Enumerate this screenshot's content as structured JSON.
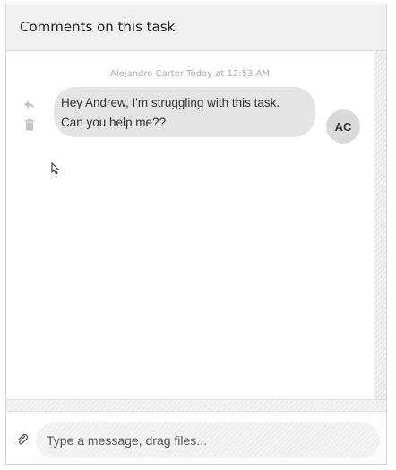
{
  "header": {
    "title": "Comments on this task"
  },
  "thread": {
    "messages": [
      {
        "author": "Alejandro Carter",
        "meta": "Alejandro Carter Today at 12:53 AM",
        "text": "Hey Andrew, I'm struggling with this task. Can you help me??",
        "avatar_initials": "AC"
      }
    ]
  },
  "actions": {
    "reply_icon": "reply-icon",
    "delete_icon": "trash-icon"
  },
  "composer": {
    "placeholder": "Type a message, drag files...",
    "attach_icon": "paperclip-icon"
  },
  "colors": {
    "header_bg": "#f1f1f1",
    "bubble_bg": "#e4e4e4",
    "avatar_bg": "#dadada"
  }
}
